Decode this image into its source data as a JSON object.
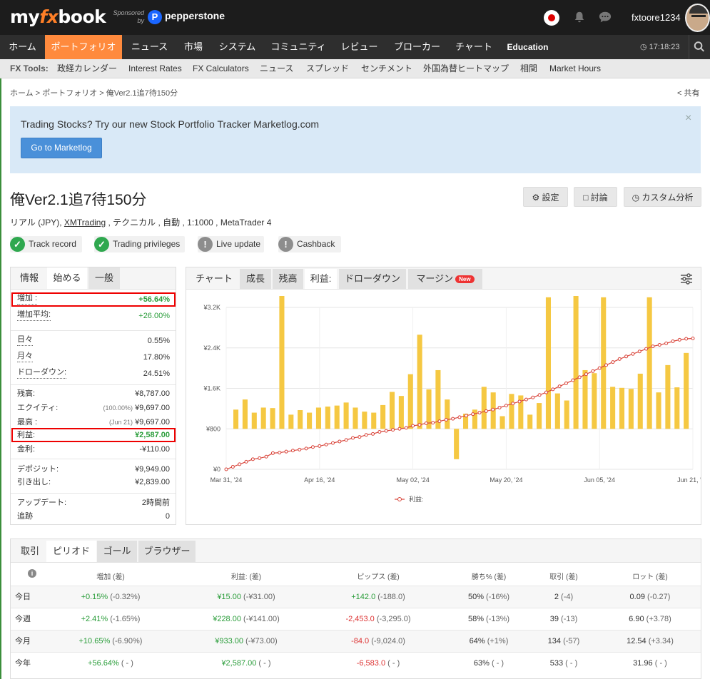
{
  "header": {
    "logo": {
      "pre": "my",
      "fx": "fx",
      "post": "book"
    },
    "sponsor_line1": "Sponsored",
    "sponsor_line2": "by",
    "sponsor_logo_letter": "P",
    "sponsor_name": "pepperstone",
    "username": "fxtoore1234"
  },
  "nav": {
    "items": [
      "ホーム",
      "ポートフォリオ",
      "ニュース",
      "市場",
      "システム",
      "コミュニティ",
      "レビュー",
      "ブローカー",
      "チャート",
      "Education"
    ],
    "active_index": 1,
    "clock": "17:18:23"
  },
  "tools": {
    "label": "FX Tools:",
    "items": [
      "政経カレンダー",
      "Interest Rates",
      "FX Calculators",
      "ニュース",
      "スプレッド",
      "センチメント",
      "外国為替ヒートマップ",
      "相関",
      "Market Hours"
    ]
  },
  "breadcrumb": {
    "home": "ホーム",
    "sep": ">",
    "portfolio": "ポートフォリオ",
    "current": "俺Ver2.1追7待150分"
  },
  "share_label": "共有",
  "promo": {
    "text": "Trading Stocks? Try our new Stock Portfolio Tracker Marketlog.com",
    "button": "Go to Marketlog",
    "close": "×"
  },
  "account": {
    "title": "俺Ver2.1追7待150分",
    "sub_pre": "リアル (JPY), ",
    "broker": "XMTrading",
    "sub_post": " , テクニカル , 自動 , 1:1000 , MetaTrader 4",
    "buttons": {
      "settings": "設定",
      "discuss": "討論",
      "custom": "カスタム分析"
    },
    "badges": [
      {
        "label": "Track record",
        "status": "ok"
      },
      {
        "label": "Trading privileges",
        "status": "ok"
      },
      {
        "label": "Live update",
        "status": "info"
      },
      {
        "label": "Cashback",
        "status": "info"
      }
    ]
  },
  "info": {
    "tabs": [
      "情報",
      "始める",
      "一般"
    ],
    "rows": {
      "gain": {
        "label": "増加 :",
        "value": "+56.64%"
      },
      "abs_gain": {
        "label": "増加平均:",
        "value": "+26.00%"
      },
      "daily": {
        "label": "日々",
        "value": "0.55%"
      },
      "monthly": {
        "label": "月々",
        "value": "17.80%"
      },
      "drawdown": {
        "label": "ドローダウン:",
        "value": "24.51%"
      },
      "balance": {
        "label": "残高:",
        "value": "¥8,787.00"
      },
      "equity": {
        "label": "エクイティ:",
        "pre": "(100.00%)",
        "value": "¥9,697.00"
      },
      "highest": {
        "label": "最高 :",
        "pre": "(Jun 21)",
        "value": "¥9,697.00"
      },
      "profit": {
        "label": "利益:",
        "value": "¥2,587.00"
      },
      "interest": {
        "label": "金利:",
        "value": "-¥110.00"
      },
      "deposits": {
        "label": "デポジット:",
        "value": "¥9,949.00"
      },
      "withdrawals": {
        "label": "引き出し:",
        "value": "¥2,839.00"
      },
      "updated": {
        "label": "アップデート:",
        "value": "2時間前"
      },
      "tracking": {
        "label": "追跡",
        "value": "0"
      }
    }
  },
  "chart_tabs": [
    "チャート",
    "成長",
    "残高",
    "利益:",
    "ドローダウン",
    "マージン"
  ],
  "chart_new_badge": "New",
  "chart_data": {
    "type": "bar",
    "y_axis_ticks": [
      "¥0",
      "¥800",
      "¥1.6K",
      "¥2.4K",
      "¥3.2K"
    ],
    "ylim": [
      0,
      3200
    ],
    "x_axis_ticks": [
      "Mar 31, '24",
      "Apr 16, '24",
      "May 02, '24",
      "May 20, '24",
      "Jun 05, '24",
      "Jun 21, '24"
    ],
    "legend": "利益:",
    "bars": [
      380,
      580,
      320,
      420,
      410,
      3250,
      280,
      370,
      320,
      420,
      440,
      460,
      520,
      420,
      340,
      320,
      470,
      730,
      650,
      1080,
      1860,
      780,
      1160,
      580,
      -600,
      300,
      380,
      830,
      720,
      250,
      690,
      660,
      280,
      510,
      2600,
      700,
      560,
      2860,
      1160,
      1100,
      2600,
      830,
      810,
      790,
      1090,
      2600,
      720,
      1260,
      820,
      1500
    ],
    "line": [
      0,
      50,
      100,
      150,
      200,
      220,
      250,
      320,
      330,
      350,
      370,
      390,
      410,
      440,
      460,
      490,
      520,
      550,
      580,
      620,
      640,
      680,
      700,
      740,
      760,
      780,
      800,
      820,
      860,
      880,
      910,
      920,
      950,
      980,
      1000,
      1030,
      1060,
      1090,
      1120,
      1150,
      1180,
      1220,
      1260,
      1300,
      1340,
      1380,
      1420,
      1470,
      1520,
      1580,
      1640,
      1700,
      1760,
      1820,
      1880,
      1940,
      2000,
      2060,
      2120,
      2180,
      2230,
      2280,
      2330,
      2380,
      2430,
      2460,
      2490,
      2530,
      2560,
      2580,
      2587
    ]
  },
  "period_tabs": [
    "取引",
    "ピリオド",
    "ゴール",
    "ブラウザー"
  ],
  "period_table": {
    "info_icon": "i",
    "headers": [
      "増加 (差)",
      "利益: (差)",
      "ピップス (差)",
      "勝ち% (差)",
      "取引 (差)",
      "ロット (差)"
    ],
    "rows": [
      {
        "name": "今日",
        "gain": "+0.15%",
        "gain_d": "(-0.32%)",
        "profit": "¥15.00",
        "profit_d": "(-¥31.00)",
        "pips": "+142.0",
        "pips_d": "(-188.0)",
        "win": "50%",
        "win_d": "(-16%)",
        "trades": "2",
        "trades_d": "(-4)",
        "lots": "0.09",
        "lots_d": "(-0.27)"
      },
      {
        "name": "今週",
        "gain": "+2.41%",
        "gain_d": "(-1.65%)",
        "profit": "¥228.00",
        "profit_d": "(-¥141.00)",
        "pips": "-2,453.0",
        "pips_d": "(-3,295.0)",
        "win": "58%",
        "win_d": "(-13%)",
        "trades": "39",
        "trades_d": "(-13)",
        "lots": "6.90",
        "lots_d": "(+3.78)"
      },
      {
        "name": "今月",
        "gain": "+10.65%",
        "gain_d": "(-6.90%)",
        "profit": "¥933.00",
        "profit_d": "(-¥73.00)",
        "pips": "-84.0",
        "pips_d": "(-9,024.0)",
        "win": "64%",
        "win_d": "(+1%)",
        "trades": "134",
        "trades_d": "(-57)",
        "lots": "12.54",
        "lots_d": "(+3.34)"
      },
      {
        "name": "今年",
        "gain": "+56.64%",
        "gain_d": "( - )",
        "profit": "¥2,587.00",
        "profit_d": "( - )",
        "pips": "-6,583.0",
        "pips_d": "( - )",
        "win": "63%",
        "win_d": "( - )",
        "trades": "533",
        "trades_d": "( - )",
        "lots": "31.96",
        "lots_d": "( - )"
      }
    ]
  },
  "colors": {
    "accent": "#ff8a3d",
    "bar": "#f5c842",
    "line": "#d9453b",
    "positive": "#2a9d3a",
    "negative": "#d33333",
    "highlight_box": "#e00000"
  }
}
